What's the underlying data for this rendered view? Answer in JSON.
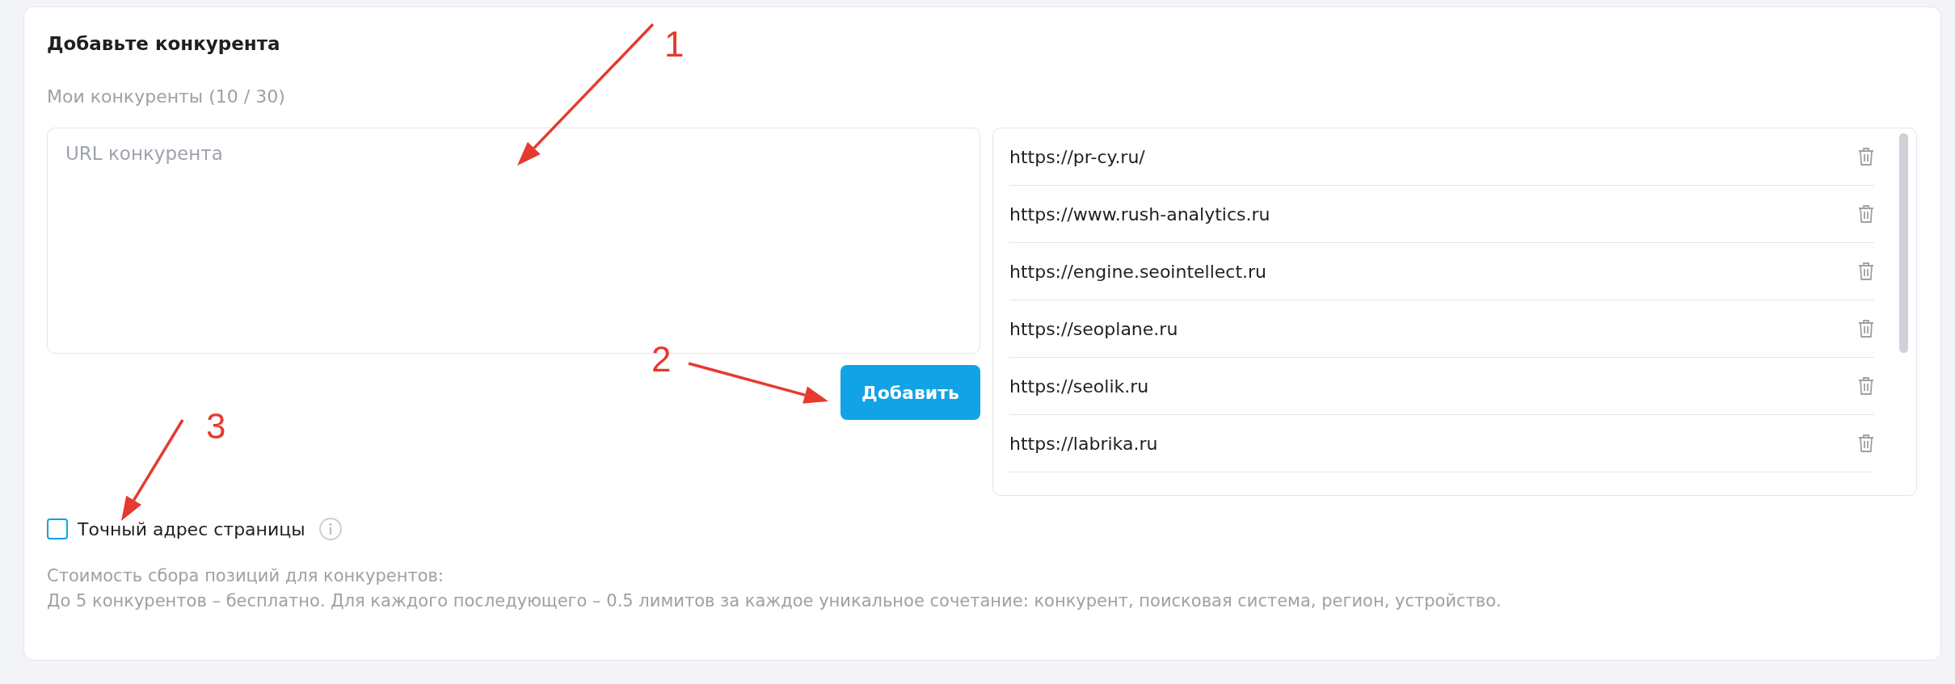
{
  "title": "Добавьте конкурента",
  "counter": "Мои конкуренты (10 / 30)",
  "url_field": {
    "placeholder": "URL конкурента"
  },
  "add_button": "Добавить",
  "competitors": [
    {
      "url": "https://pr-cy.ru/"
    },
    {
      "url": "https://www.rush-analytics.ru"
    },
    {
      "url": "https://engine.seointellect.ru"
    },
    {
      "url": "https://seoplane.ru"
    },
    {
      "url": "https://seolik.ru"
    },
    {
      "url": "https://labrika.ru"
    }
  ],
  "exact_page": {
    "label": "Точный адрес страницы",
    "checked": false
  },
  "cost_note": [
    "Стоимость сбора позиций для конкурентов:",
    "До 5 конкурентов – бесплатно. Для каждого последующего – 0.5 лимитов за каждое уникальное сочетание: конкурент, поисковая система, регион, устройство."
  ],
  "annotations": [
    {
      "label": "1"
    },
    {
      "label": "2"
    },
    {
      "label": "3"
    }
  ]
}
